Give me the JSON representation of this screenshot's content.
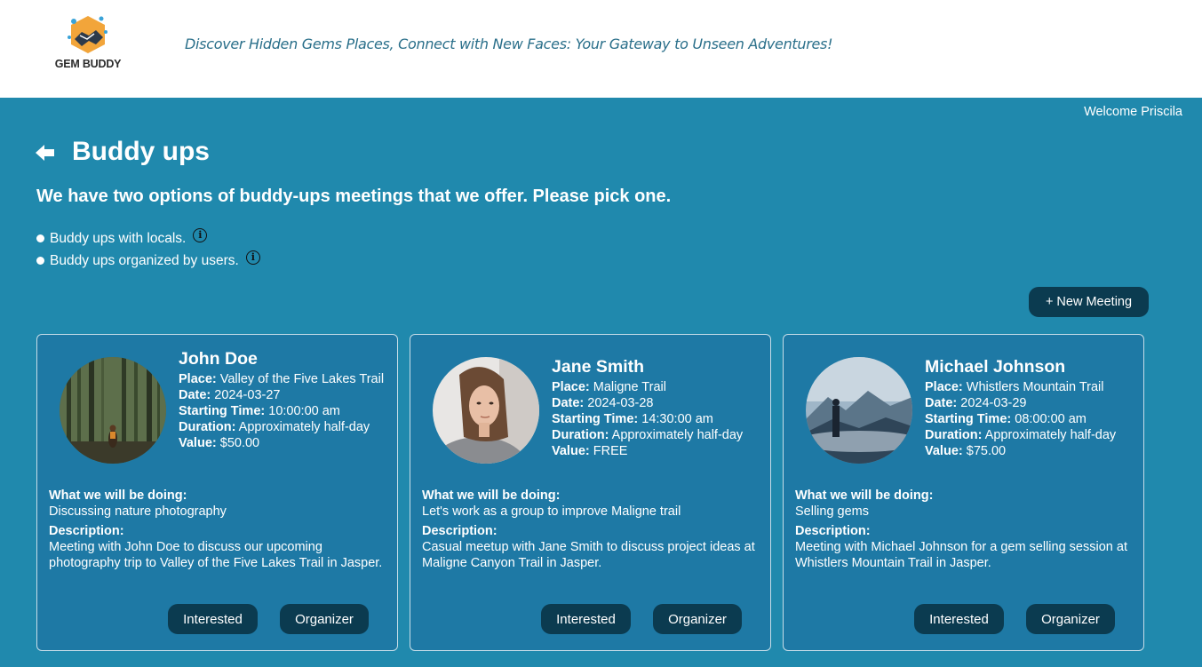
{
  "header": {
    "logo_text": "GEM BUDDY",
    "tagline": "Discover Hidden Gems Places, Connect with New Faces: Your Gateway to Unseen Adventures!"
  },
  "user": {
    "welcome": "Welcome Priscila"
  },
  "page": {
    "title": "Buddy ups",
    "subtitle": "We have two options of buddy-ups meetings that we offer. Please pick one.",
    "options": [
      {
        "label": "Buddy ups with locals."
      },
      {
        "label": "Buddy ups organized by users."
      }
    ],
    "info_glyph": "i",
    "new_meeting_label": "+ New Meeting"
  },
  "labels": {
    "place": "Place:",
    "date": "Date:",
    "starting_time": "Starting Time:",
    "duration": "Duration:",
    "value": "Value:",
    "doing": "What we will be doing:",
    "description": "Description:",
    "interested": "Interested",
    "organizer": "Organizer"
  },
  "meetings": [
    {
      "name": "John Doe",
      "place": "Valley of the Five Lakes Trail",
      "date": "2024-03-27",
      "starting_time": "10:00:00 am",
      "duration": "Approximately half-day",
      "value": "$50.00",
      "doing": "Discussing nature photography",
      "description": "Meeting with John Doe to discuss our upcoming photography trip to Valley of the Five Lakes Trail in Jasper."
    },
    {
      "name": "Jane Smith",
      "place": "Maligne Trail",
      "date": "2024-03-28",
      "starting_time": "14:30:00 am",
      "duration": "Approximately half-day",
      "value": "FREE",
      "doing": "Let's work as a group to improve Maligne trail",
      "description": "Casual meetup with Jane Smith to discuss project ideas at Maligne Canyon Trail in Jasper."
    },
    {
      "name": "Michael Johnson",
      "place": "Whistlers Mountain Trail",
      "date": "2024-03-29",
      "starting_time": "08:00:00 am",
      "duration": "Approximately half-day",
      "value": "$75.00",
      "doing": "Selling gems",
      "description": "Meeting with Michael Johnson for a gem selling session at Whistlers Mountain Trail in Jasper."
    }
  ]
}
